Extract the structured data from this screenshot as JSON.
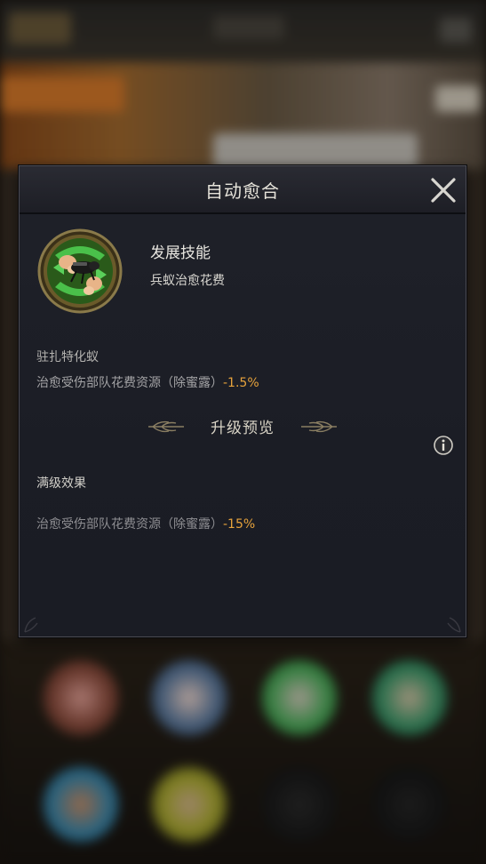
{
  "dialog": {
    "title": "自动愈合",
    "close_icon": "close-icon"
  },
  "skill": {
    "icon": "skill-ant-heal-icon",
    "name": "发展技能",
    "subtitle": "兵蚁治愈花费"
  },
  "current": {
    "label": "驻扎特化蚁",
    "effect_text": "治愈受伤部队花费资源（除蜜露）",
    "effect_value": "-1.5%"
  },
  "upgrade_preview": {
    "title": "升级预览",
    "info_icon": "info-icon"
  },
  "max_level": {
    "label": "满级效果",
    "effect_text": "治愈受伤部队花费资源（除蜜露）",
    "effect_value": "-15%"
  },
  "colors": {
    "accent_value": "#e7a33c",
    "dialog_bg": "#1d1f27",
    "title_text": "#e6e3da"
  }
}
